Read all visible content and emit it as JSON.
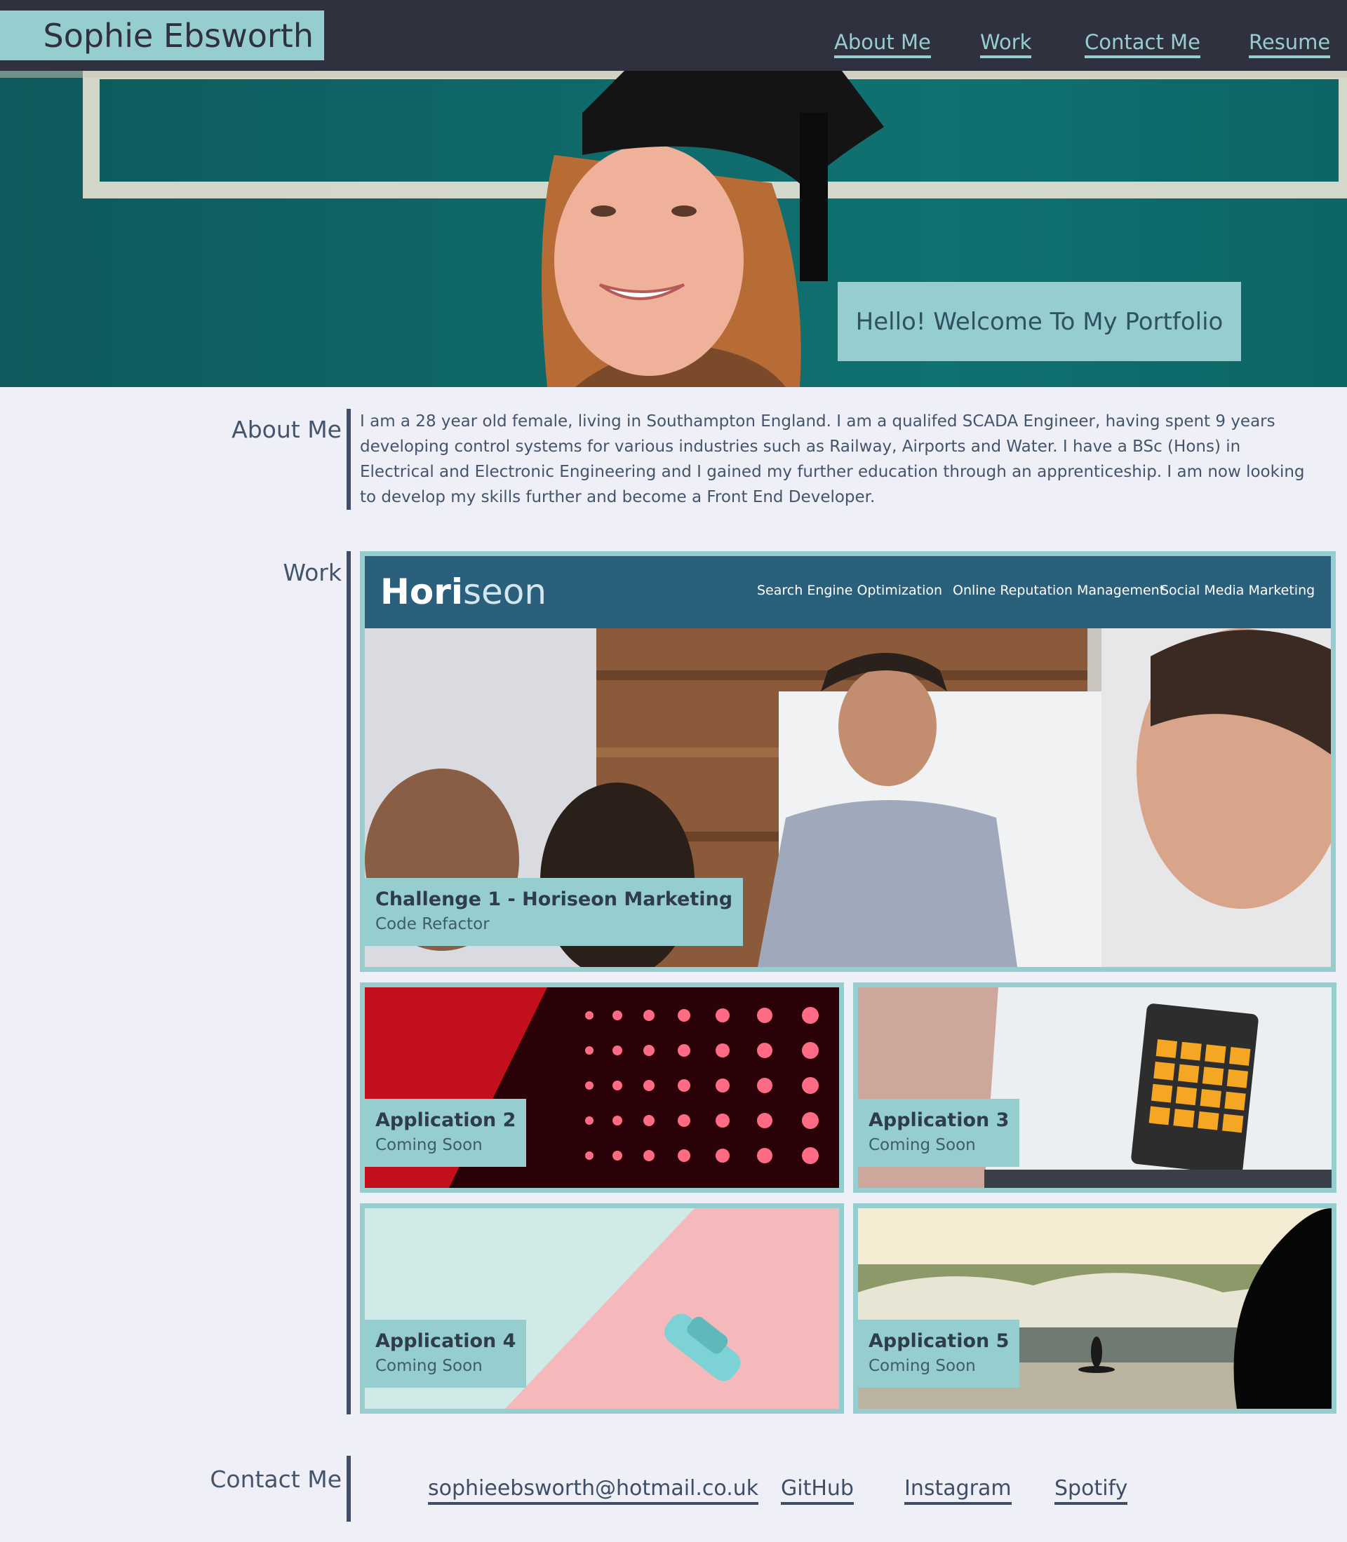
{
  "header": {
    "name": "Sophie Ebsworth",
    "nav": [
      "About Me",
      "Work",
      "Contact Me",
      "Resume"
    ]
  },
  "hero": {
    "banner": "Hello! Welcome To My Portfolio"
  },
  "about": {
    "heading": "About Me",
    "text": "I am a 28 year old female, living in Southampton England. I am a qualifed SCADA Engineer, having spent 9 years developing control systems for various industries such as Railway, Airports and Water. I have a BSc (Hons) in Electrical and Electronic Engineering and I gained my further education through an apprenticeship. I am now looking to develop my skills further and become a Front End Developer."
  },
  "work": {
    "heading": "Work",
    "featured": {
      "title": "Challenge 1 - Horiseon Marketing",
      "subtitle": "Code Refactor",
      "screenshot": {
        "logo_a": "Hori",
        "logo_b": "seon",
        "nav": [
          "Search Engine Optimization",
          "Online Reputation Management",
          "Social Media Marketing"
        ]
      }
    },
    "apps": [
      {
        "title": "Application 2",
        "subtitle": "Coming Soon"
      },
      {
        "title": "Application 3",
        "subtitle": "Coming Soon"
      },
      {
        "title": "Application 4",
        "subtitle": "Coming Soon"
      },
      {
        "title": "Application 5",
        "subtitle": "Coming Soon"
      }
    ]
  },
  "contact": {
    "heading": "Contact Me",
    "links": [
      "sophieebsworth@hotmail.co.uk",
      "GitHub",
      "Instagram",
      "Spotify"
    ]
  },
  "colors": {
    "header_bg": "#2f313e",
    "accent": "#96cecf",
    "page_bg": "#efeff7",
    "text": "#44546a"
  }
}
